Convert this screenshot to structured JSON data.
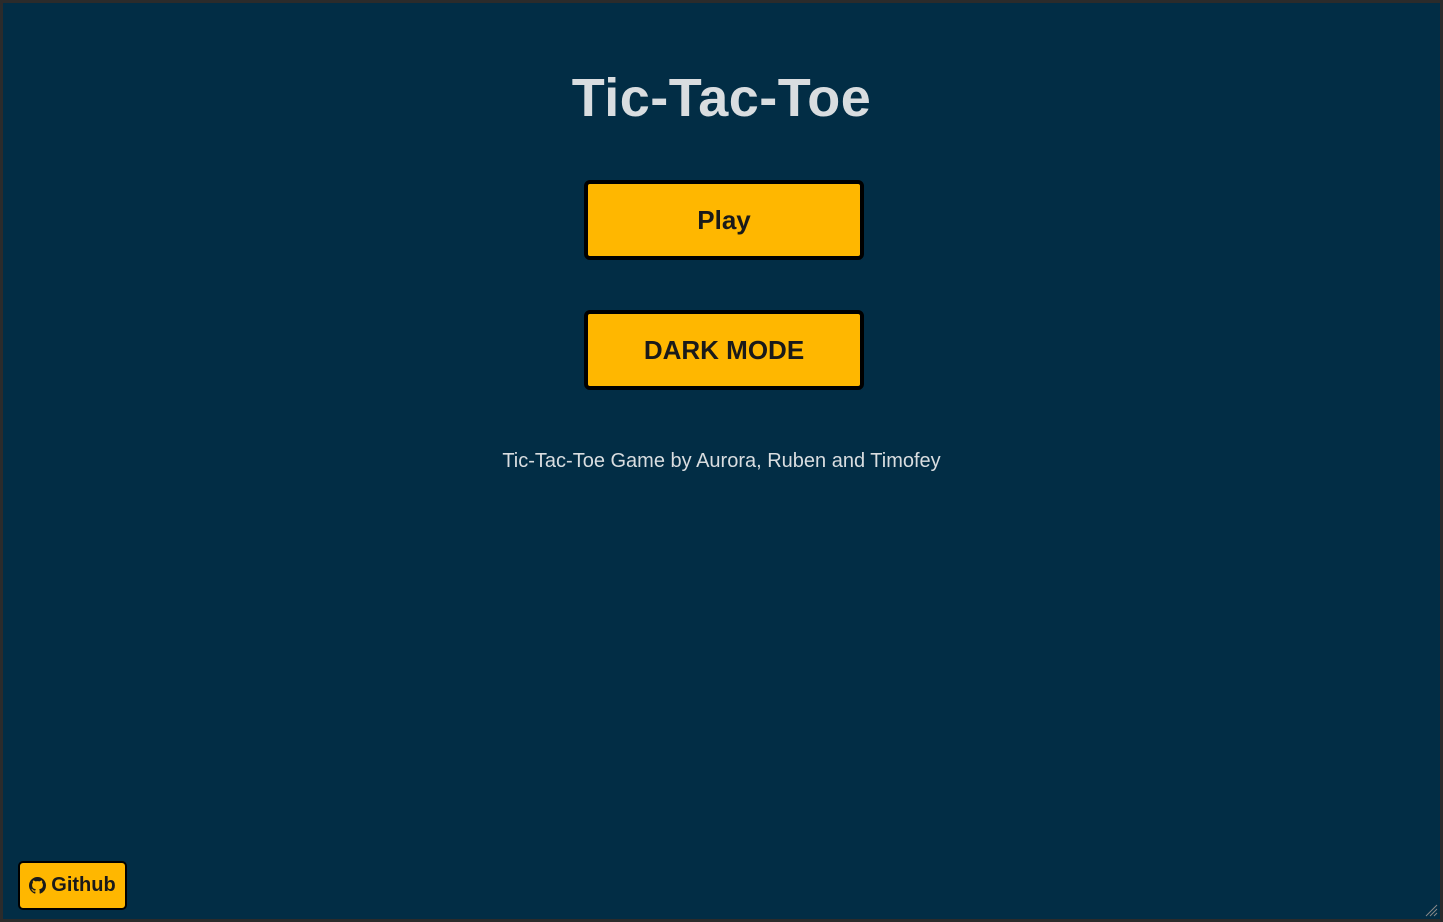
{
  "page": {
    "title": "Tic-Tac-Toe"
  },
  "menu": {
    "play_label": "Play",
    "dark_mode_label": "DARK MODE"
  },
  "footer": {
    "credits": "Tic-Tac-Toe Game by Aurora, Ruben and Timofey",
    "github_label": "Github"
  },
  "icons": {
    "github": "github-icon",
    "resize": "resize-handle-icon"
  },
  "colors": {
    "background": "#022d45",
    "accent": "#ffb700",
    "text": "#d9dde0",
    "button_border": "#000000"
  }
}
